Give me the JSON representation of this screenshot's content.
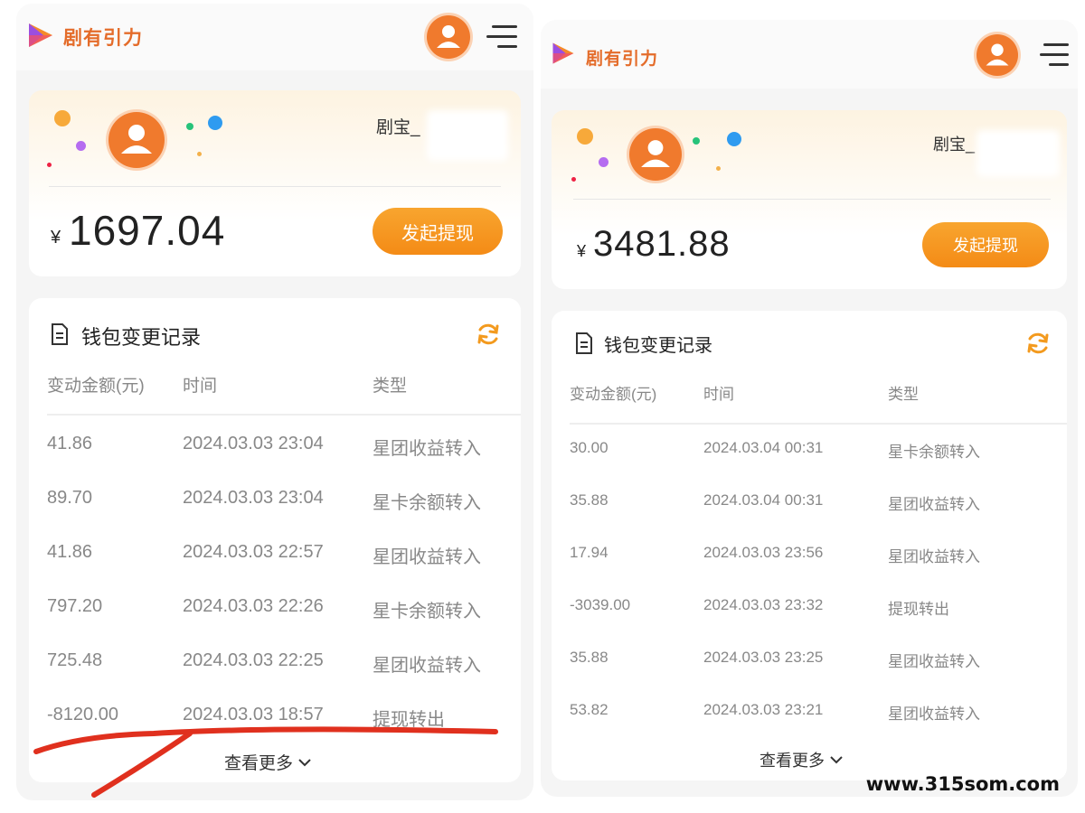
{
  "watermark": "www.315som.com",
  "colors": {
    "brand": "#f07a2d",
    "button": "#f48b16",
    "annotation": "#e0301e"
  },
  "screens": [
    {
      "app_name": "剧有引力",
      "username": "剧宝_",
      "currency": "¥",
      "balance": "1697.04",
      "withdraw_label": "发起提现",
      "records_title": "钱包变更记录",
      "columns": [
        "变动金额(元)",
        "时间",
        "类型"
      ],
      "rows": [
        {
          "amount": "41.86",
          "time": "2024.03.03 23:04",
          "type": "星团收益转入"
        },
        {
          "amount": "89.70",
          "time": "2024.03.03 23:04",
          "type": "星卡余额转入"
        },
        {
          "amount": "41.86",
          "time": "2024.03.03 22:57",
          "type": "星团收益转入"
        },
        {
          "amount": "797.20",
          "time": "2024.03.03 22:26",
          "type": "星卡余额转入"
        },
        {
          "amount": "725.48",
          "time": "2024.03.03 22:25",
          "type": "星团收益转入"
        },
        {
          "amount": "-8120.00",
          "time": "2024.03.03 18:57",
          "type": "提现转出"
        }
      ],
      "more_label": "查看更多"
    },
    {
      "app_name": "剧有引力",
      "username": "剧宝_",
      "currency": "¥",
      "balance": "3481.88",
      "withdraw_label": "发起提现",
      "records_title": "钱包变更记录",
      "columns": [
        "变动金额(元)",
        "时间",
        "类型"
      ],
      "rows": [
        {
          "amount": "30.00",
          "time": "2024.03.04 00:31",
          "type": "星卡余额转入"
        },
        {
          "amount": "35.88",
          "time": "2024.03.04 00:31",
          "type": "星团收益转入"
        },
        {
          "amount": "17.94",
          "time": "2024.03.03 23:56",
          "type": "星团收益转入"
        },
        {
          "amount": "-3039.00",
          "time": "2024.03.03 23:32",
          "type": "提现转出"
        },
        {
          "amount": "35.88",
          "time": "2024.03.03 23:25",
          "type": "星团收益转入"
        },
        {
          "amount": "53.82",
          "time": "2024.03.03 23:21",
          "type": "星团收益转入"
        }
      ],
      "more_label": "查看更多"
    }
  ]
}
